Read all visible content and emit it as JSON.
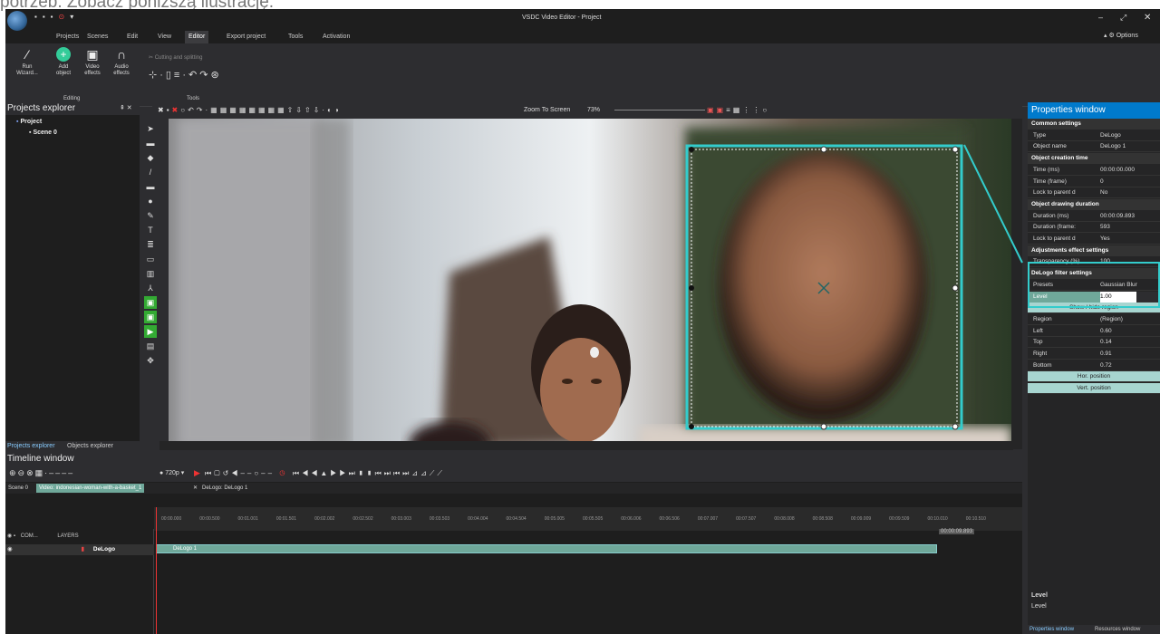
{
  "caption": "potrzeb. Zobacz poniższą ilustrację.",
  "window_title": "VSDC Video Editor - Project",
  "menu": [
    "Projects",
    "Scenes",
    "Edit",
    "View",
    "Editor",
    "Export project",
    "Tools",
    "Activation"
  ],
  "active_menu": "Editor",
  "options_label": "Options",
  "ribbon": {
    "run_wizard": "Run Wizard...",
    "add_object": "Add object",
    "video_effects": "Video effects",
    "audio_effects": "Audio effects",
    "editing_label": "Editing",
    "cutting_label": "Cutting and splitting",
    "tools_label": "Tools"
  },
  "projects_explorer": {
    "title": "Projects explorer",
    "project": "Project",
    "scene": "Scene 0",
    "tab_projects": "Projects explorer",
    "tab_objects": "Objects explorer"
  },
  "toolbar": {
    "zoom_label": "Zoom To Screen",
    "zoom_value": "73%"
  },
  "properties": {
    "title": "Properties window",
    "rows": [
      {
        "k": "Common settings",
        "v": "",
        "type": "sec"
      },
      {
        "k": "Type",
        "v": "DeLogo",
        "type": ""
      },
      {
        "k": "Object name",
        "v": "DeLogo 1",
        "type": ""
      },
      {
        "k": "Object creation time",
        "v": "",
        "type": "sec"
      },
      {
        "k": "Time (ms)",
        "v": "00:00:00.000",
        "type": ""
      },
      {
        "k": "Time (frame)",
        "v": "0",
        "type": ""
      },
      {
        "k": "Lock to parent d",
        "v": "No",
        "type": ""
      },
      {
        "k": "Object drawing duration",
        "v": "",
        "type": "sec"
      },
      {
        "k": "Duration (ms)",
        "v": "00:00:09.893",
        "type": ""
      },
      {
        "k": "Duration (frame:",
        "v": "593",
        "type": ""
      },
      {
        "k": "Lock to parent d",
        "v": "Yes",
        "type": ""
      },
      {
        "k": "Adjustments effect settings",
        "v": "",
        "type": "sec"
      },
      {
        "k": "Transparency (%)",
        "v": "100",
        "type": ""
      },
      {
        "k": "DeLogo filter settings",
        "v": "",
        "type": "sec"
      },
      {
        "k": "Presets",
        "v": "Gaussian Blur",
        "type": ""
      },
      {
        "k": "Level",
        "v": "1.00",
        "type": "hl"
      },
      {
        "k": "Show / hide region",
        "v": "",
        "type": "btn"
      },
      {
        "k": "Region",
        "v": "(Region)",
        "type": ""
      },
      {
        "k": "Left",
        "v": "0.60",
        "type": ""
      },
      {
        "k": "Top",
        "v": "0.14",
        "type": ""
      },
      {
        "k": "Right",
        "v": "0.91",
        "type": ""
      },
      {
        "k": "Bottom",
        "v": "0.72",
        "type": ""
      },
      {
        "k": "Hor. position",
        "v": "",
        "type": "btn"
      },
      {
        "k": "Vert. position",
        "v": "",
        "type": "btn"
      }
    ],
    "desc_title": "Level",
    "desc_text": "Level",
    "tab_props": "Properties window",
    "tab_res": "Resources window"
  },
  "timeline": {
    "title": "Timeline window",
    "resolution": "720p",
    "tabs": [
      "Scene 0",
      "Video: indonesian-woman-with-a-basket_1",
      "DeLogo: DeLogo 1"
    ],
    "com_label": "COM...",
    "layers_label": "LAYERS",
    "track": "DeLogo",
    "clip": "DeLogo 1",
    "ticks": [
      "00:00.000",
      "00:00.500",
      "00:01.001",
      "00:01.501",
      "00:02.002",
      "00:02.502",
      "00:03.003",
      "00:03.503",
      "00:04.004",
      "00:04.504",
      "00:05.005",
      "00:05.505",
      "00:06.006",
      "00:06.506",
      "00:07.007",
      "00:07.507",
      "00:08.008",
      "00:08.508",
      "00:09.009",
      "00:09.509",
      "00:10.010",
      "00:10.510"
    ],
    "end_time": "00:00:09.893"
  }
}
